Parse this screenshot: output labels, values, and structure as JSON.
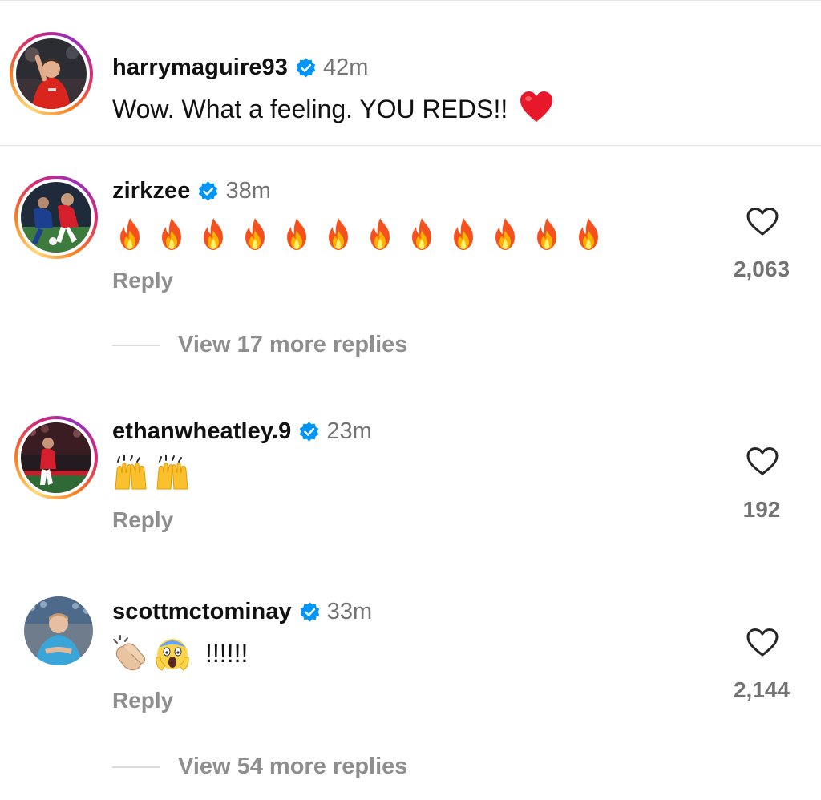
{
  "caption": {
    "username": "harrymaguire93",
    "time": "42m",
    "text": "Wow. What a feeling. YOU REDS!!",
    "emoji_icon": "red-heart-icon"
  },
  "comments": [
    {
      "username": "zirkzee",
      "time": "38m",
      "emoji": "fire",
      "emoji_count": 12,
      "reply_label": "Reply",
      "likes": "2,063",
      "view_replies": "View 17 more replies"
    },
    {
      "username": "ethanwheatley.9",
      "time": "23m",
      "emoji": "raising-hands",
      "emoji_count": 2,
      "reply_label": "Reply",
      "likes": "192"
    },
    {
      "username": "scottmctominay",
      "time": "33m",
      "emoji": "clapping-hands, screaming-face",
      "text": "!!!!!!",
      "reply_label": "Reply",
      "likes": "2,144",
      "view_replies": "View 54 more replies"
    }
  ],
  "colors": {
    "verified": "#0095f6",
    "muted_text": "#8e8e8e",
    "time_text": "#737373",
    "story_ring": [
      "#feda75",
      "#fa7e1e",
      "#d62976",
      "#962fbf"
    ]
  }
}
